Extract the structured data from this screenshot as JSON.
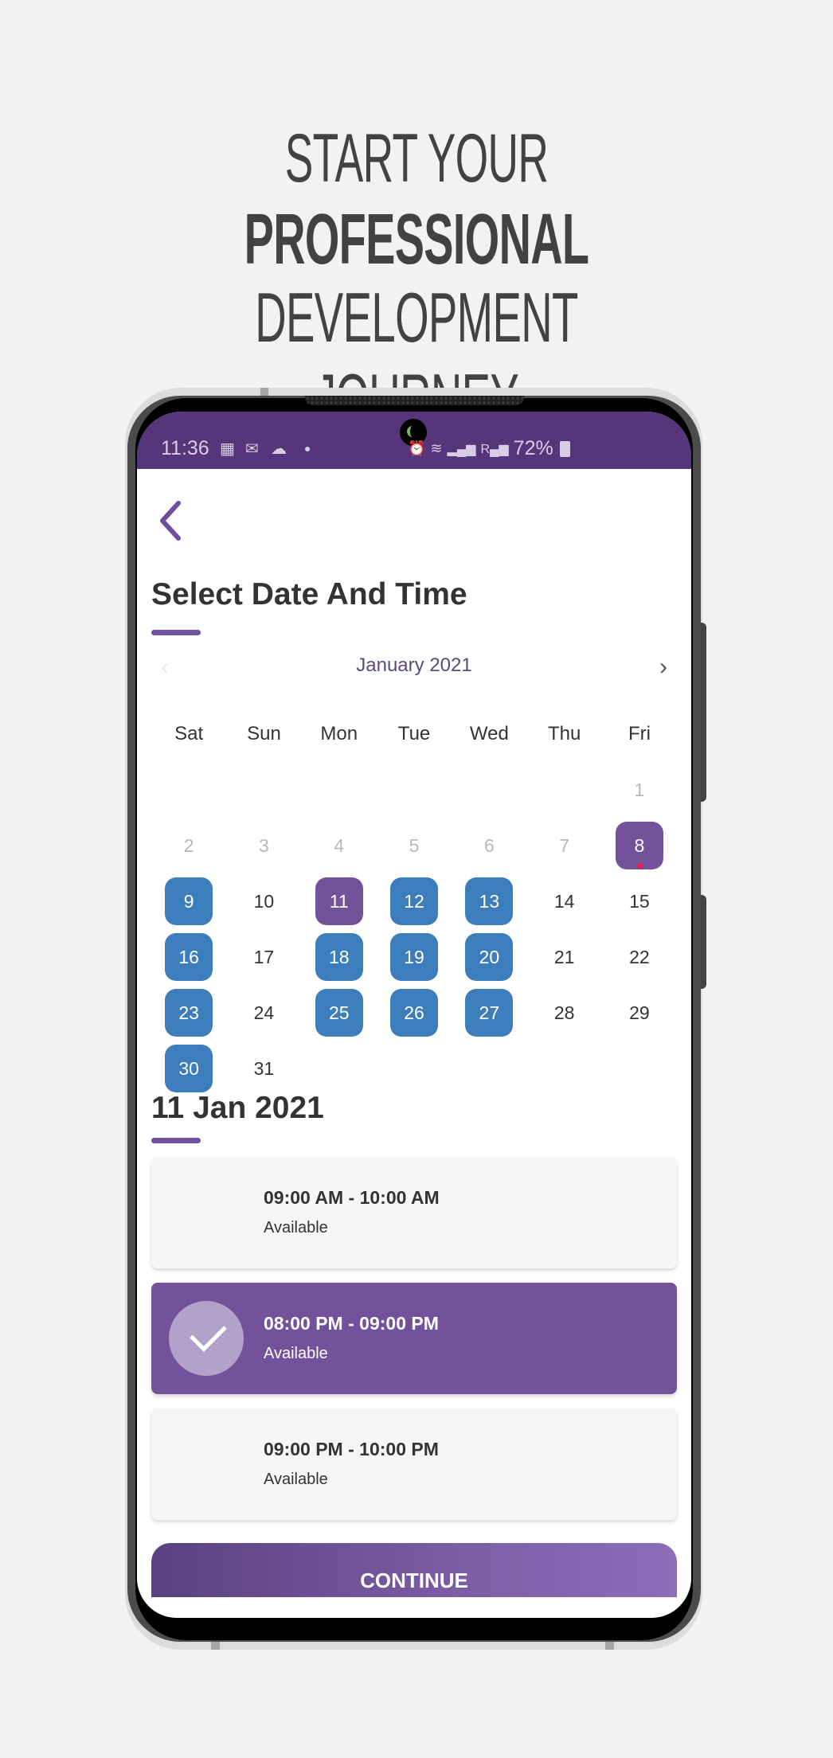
{
  "headline": {
    "line1": "START YOUR",
    "line2": "PROFESSIONAL",
    "line3": "DEVELOPMENT JOURNEY"
  },
  "status_bar": {
    "time": "11:36",
    "battery": "72%",
    "icons_left": [
      "gallery-icon",
      "mail-icon",
      "cloud-icon",
      "dot-icon"
    ],
    "icons_right": [
      "alarm-icon",
      "wifi-icon",
      "signal-icon",
      "signal-roaming-icon",
      "battery-icon"
    ]
  },
  "page": {
    "title": "Select Date And Time",
    "accent_color": "#74529b",
    "available_color": "#3c7dbb"
  },
  "calendar": {
    "month_label": "January 2021",
    "weekdays": [
      "Sat",
      "Sun",
      "Mon",
      "Tue",
      "Wed",
      "Thu",
      "Fri"
    ],
    "leading_blanks": 6,
    "days": [
      {
        "d": "1",
        "state": "muted"
      },
      {
        "d": "2",
        "state": "muted"
      },
      {
        "d": "3",
        "state": "muted"
      },
      {
        "d": "4",
        "state": "muted"
      },
      {
        "d": "5",
        "state": "muted"
      },
      {
        "d": "6",
        "state": "muted"
      },
      {
        "d": "7",
        "state": "muted"
      },
      {
        "d": "8",
        "state": "today"
      },
      {
        "d": "9",
        "state": "available"
      },
      {
        "d": "10",
        "state": "normal"
      },
      {
        "d": "11",
        "state": "selected"
      },
      {
        "d": "12",
        "state": "available"
      },
      {
        "d": "13",
        "state": "available"
      },
      {
        "d": "14",
        "state": "normal"
      },
      {
        "d": "15",
        "state": "normal"
      },
      {
        "d": "16",
        "state": "available"
      },
      {
        "d": "17",
        "state": "normal"
      },
      {
        "d": "18",
        "state": "available"
      },
      {
        "d": "19",
        "state": "available"
      },
      {
        "d": "20",
        "state": "available"
      },
      {
        "d": "21",
        "state": "normal"
      },
      {
        "d": "22",
        "state": "normal"
      },
      {
        "d": "23",
        "state": "available"
      },
      {
        "d": "24",
        "state": "normal"
      },
      {
        "d": "25",
        "state": "available"
      },
      {
        "d": "26",
        "state": "available"
      },
      {
        "d": "27",
        "state": "available"
      },
      {
        "d": "28",
        "state": "normal"
      },
      {
        "d": "29",
        "state": "normal"
      },
      {
        "d": "30",
        "state": "available"
      },
      {
        "d": "31",
        "state": "normal"
      }
    ]
  },
  "selected_date": "11 Jan 2021",
  "slots": [
    {
      "time": "09:00 AM - 10:00 AM",
      "status": "Available",
      "selected": false
    },
    {
      "time": "08:00 PM - 09:00 PM",
      "status": "Available",
      "selected": true
    },
    {
      "time": "09:00 PM - 10:00 PM",
      "status": "Available",
      "selected": false
    }
  ],
  "continue_label": "CONTINUE"
}
